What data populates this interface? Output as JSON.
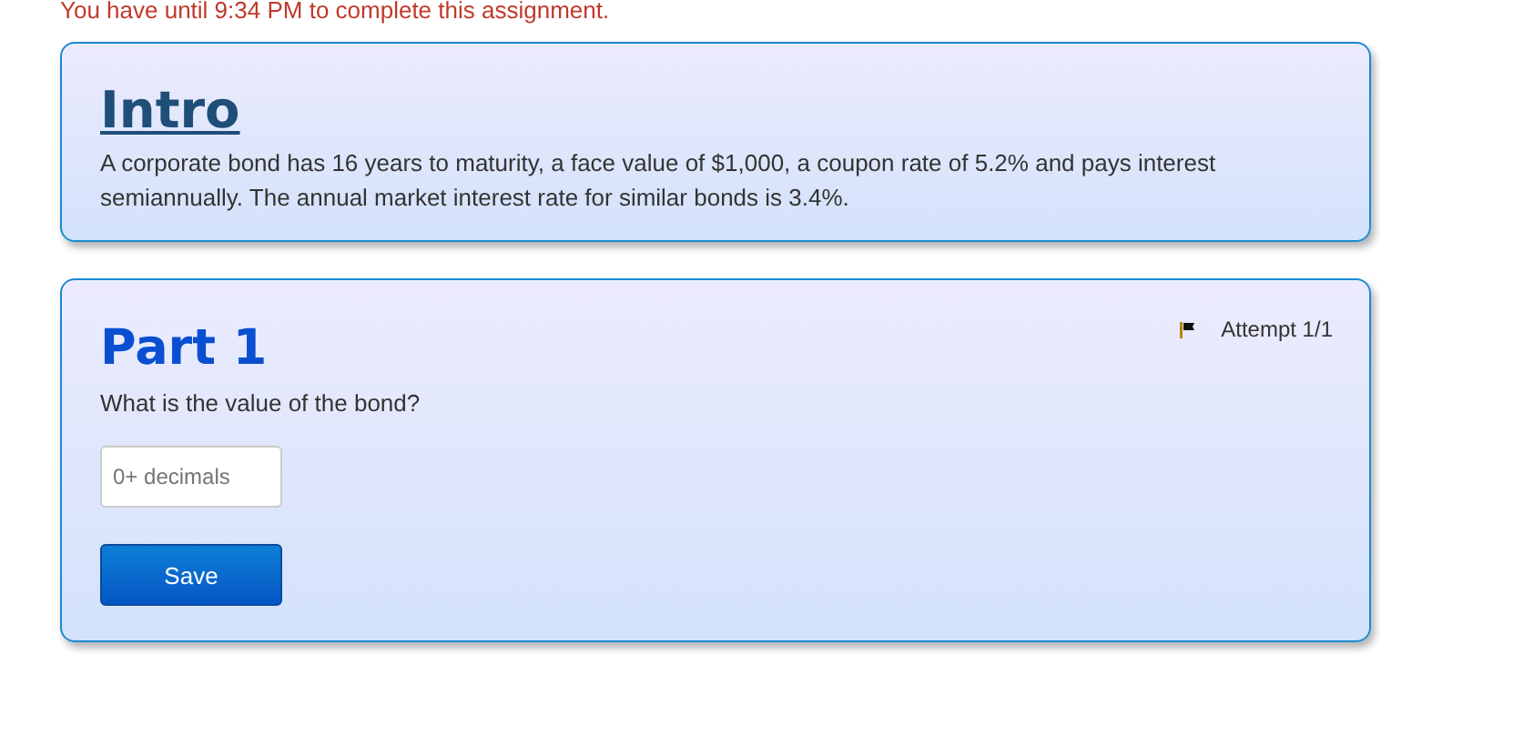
{
  "notice": "You have until 9:34 PM to complete this assignment.",
  "intro": {
    "title": "Intro",
    "text": "A corporate bond has 16 years to maturity, a face value of $1,000, a coupon rate of 5.2% and pays interest semiannually. The annual market interest rate for similar bonds is 3.4%."
  },
  "part": {
    "title": "Part 1",
    "attempt": "Attempt 1/1",
    "question": "What is the value of the bond?",
    "answer": {
      "placeholder": "0+ decimals"
    },
    "button": "Save"
  }
}
